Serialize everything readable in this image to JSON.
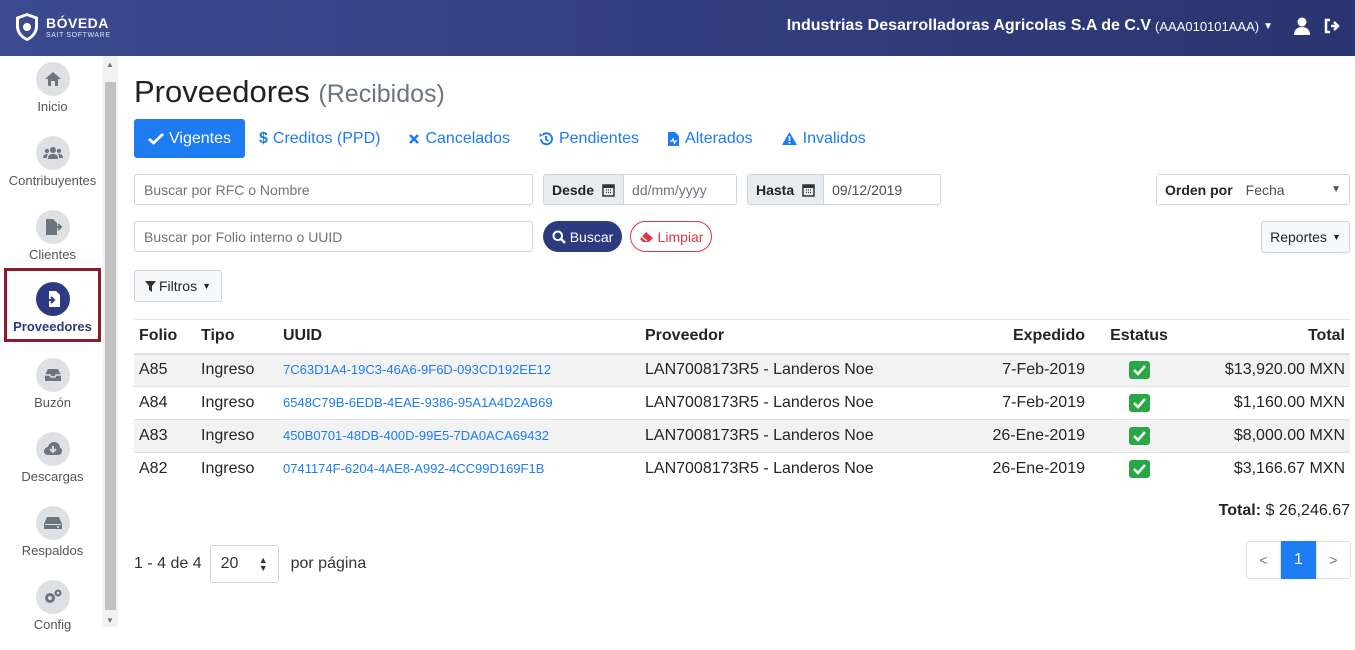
{
  "brand": {
    "name": "BÓVEDA",
    "tagline": "SAIT SOFTWARE"
  },
  "header": {
    "company": "Industrias Desarrolladoras Agricolas S.A de C.V",
    "rfc": "(AAA010101AAA)"
  },
  "sidebar": {
    "items": [
      {
        "label": "Inicio",
        "icon": "home-icon"
      },
      {
        "label": "Contribuyentes",
        "icon": "users-icon"
      },
      {
        "label": "Clientes",
        "icon": "file-export-icon"
      },
      {
        "label": "Proveedores",
        "icon": "file-import-icon",
        "active": true
      },
      {
        "label": "Buzón",
        "icon": "inbox-icon"
      },
      {
        "label": "Descargas",
        "icon": "cloud-download-icon"
      },
      {
        "label": "Respaldos",
        "icon": "hdd-icon"
      },
      {
        "label": "Config",
        "icon": "cogs-icon"
      }
    ]
  },
  "page": {
    "title": "Proveedores",
    "subtitle": "(Recibidos)"
  },
  "tabs": [
    {
      "label": "Vigentes",
      "icon": "check-icon",
      "active": true
    },
    {
      "label": "Creditos (PPD)",
      "icon": "dollar-icon"
    },
    {
      "label": "Cancelados",
      "icon": "times-icon"
    },
    {
      "label": "Pendientes",
      "icon": "history-icon"
    },
    {
      "label": "Alterados",
      "icon": "file-medical-icon"
    },
    {
      "label": "Invalidos",
      "icon": "warning-icon"
    }
  ],
  "filters": {
    "search_rfc_placeholder": "Buscar por RFC o Nombre",
    "search_folio_placeholder": "Buscar por Folio interno o UUID",
    "desde_label": "Desde",
    "desde_placeholder": "dd/mm/yyyy",
    "hasta_label": "Hasta",
    "hasta_value": "09/12/2019",
    "orden_label": "Orden por",
    "orden_value": "Fecha",
    "buscar_label": "Buscar",
    "limpiar_label": "Limpiar",
    "reportes_label": "Reportes",
    "filtros_label": "Filtros"
  },
  "table": {
    "headers": [
      "Folio",
      "Tipo",
      "UUID",
      "Proveedor",
      "Expedido",
      "Estatus",
      "Total"
    ],
    "rows": [
      {
        "folio": "A85",
        "tipo": "Ingreso",
        "uuid": "7C63D1A4-19C3-46A6-9F6D-093CD192EE12",
        "proveedor": "LAN7008173R5 - Landeros Noe",
        "expedido": "7-Feb-2019",
        "total": "$13,920.00 MXN"
      },
      {
        "folio": "A84",
        "tipo": "Ingreso",
        "uuid": "6548C79B-6EDB-4EAE-9386-95A1A4D2AB69",
        "proveedor": "LAN7008173R5 - Landeros Noe",
        "expedido": "7-Feb-2019",
        "total": "$1,160.00 MXN"
      },
      {
        "folio": "A83",
        "tipo": "Ingreso",
        "uuid": "450B0701-48DB-400D-99E5-7DA0ACA69432",
        "proveedor": "LAN7008173R5 - Landeros Noe",
        "expedido": "26-Ene-2019",
        "total": "$8,000.00 MXN"
      },
      {
        "folio": "A82",
        "tipo": "Ingreso",
        "uuid": "0741174F-6204-4AE8-A992-4CC99D169F1B",
        "proveedor": "LAN7008173R5 - Landeros Noe",
        "expedido": "26-Ene-2019",
        "total": "$3,166.67 MXN"
      }
    ]
  },
  "summary": {
    "total_label": "Total:",
    "total_value": "$ 26,246.67"
  },
  "pagination": {
    "range": "1 - 4 de 4",
    "per_page": "20",
    "per_page_label": "por página",
    "prev": "<",
    "current": "1",
    "next": ">"
  },
  "colors": {
    "primary": "#1d7cf2",
    "navy": "#2d3a80",
    "success": "#28a745",
    "danger": "#dc3545",
    "active_border": "#8b1a2c"
  }
}
